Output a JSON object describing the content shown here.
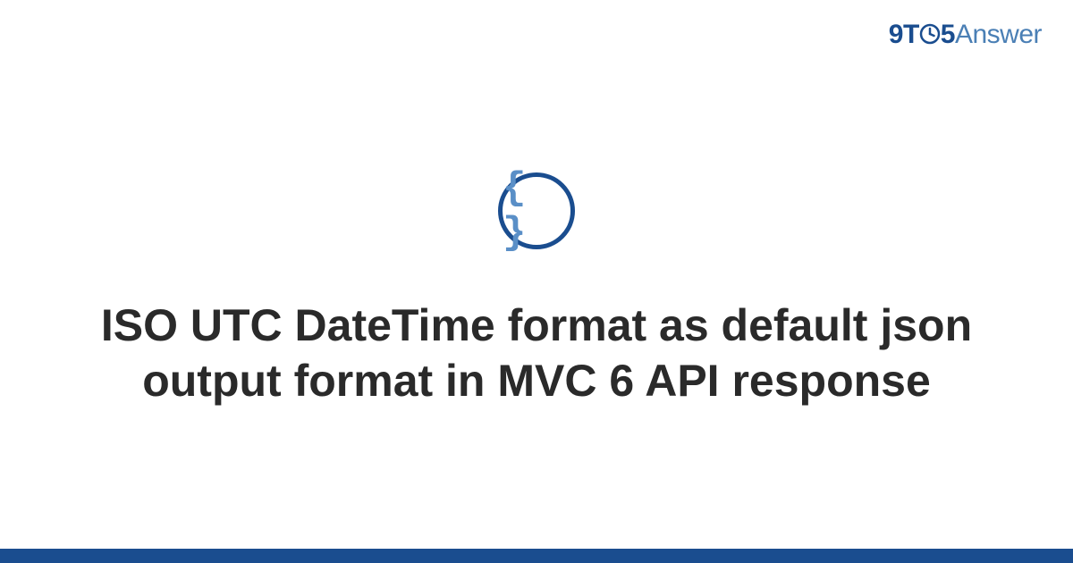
{
  "logo": {
    "nine": "9",
    "t": "T",
    "five": "5",
    "answer": "Answer"
  },
  "icon": {
    "braces": "{ }"
  },
  "title": "ISO UTC DateTime format as default json output format in MVC 6 API response"
}
